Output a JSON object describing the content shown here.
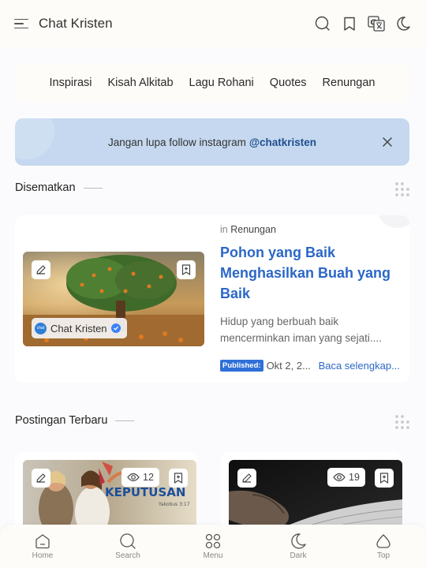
{
  "header": {
    "title": "Chat Kristen"
  },
  "nav": {
    "items": [
      "Inspirasi",
      "Kisah Alkitab",
      "Lagu Rohani",
      "Quotes",
      "Renungan"
    ]
  },
  "notice": {
    "text": "Jangan lupa follow instagram",
    "handle": "@chatkristen"
  },
  "pinned": {
    "heading": "Disematkan",
    "post": {
      "category_prefix": "in",
      "category": "Renungan",
      "title": "Pohon yang Baik Menghasilkan Buah yang Baik",
      "snippet": "Hidup yang berbuah baik mencerminkan iman yang sejati....",
      "published_label": "Published:",
      "date": "Okt 2, 2...",
      "read_more": "Baca selengkap...",
      "author": "Chat Kristen",
      "avatar_text": "chat"
    }
  },
  "latest": {
    "heading": "Postingan Terbaru",
    "posts": [
      {
        "views": "12",
        "thumb_text": "KEPUTUSAN",
        "thumb_sub": "Yakobus 3:17"
      },
      {
        "views": "19"
      }
    ]
  },
  "bottom_nav": {
    "items": [
      {
        "label": "Home",
        "icon": "home-icon"
      },
      {
        "label": "Search",
        "icon": "search-icon"
      },
      {
        "label": "Menu",
        "icon": "grid-icon"
      },
      {
        "label": "Dark",
        "icon": "moon-icon"
      },
      {
        "label": "Top",
        "icon": "arrow-up-icon"
      }
    ]
  },
  "colors": {
    "accent": "#2b67c7",
    "notice_bg": "#c5d8ef",
    "header_bg": "#fefcf8"
  }
}
